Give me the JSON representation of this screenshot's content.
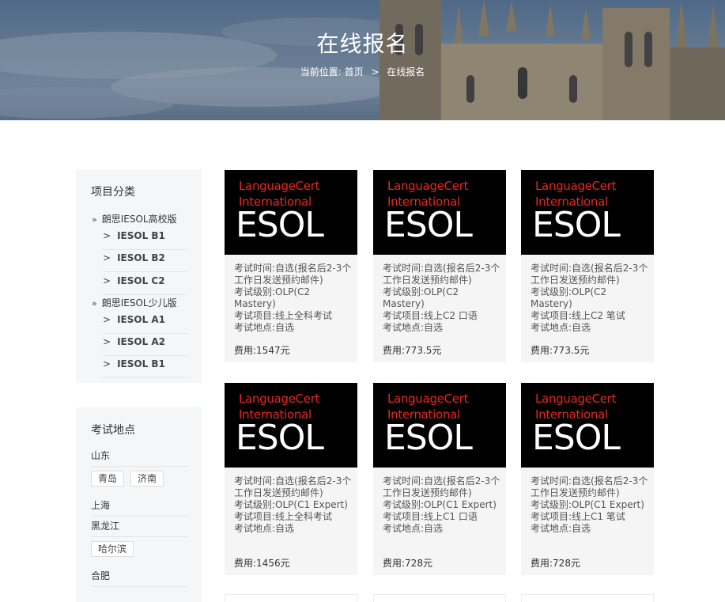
{
  "banner": {
    "title": "在线报名",
    "breadcrumb": {
      "prefix": "当前位置:",
      "home": "首页",
      "separator": ">",
      "current": "在线报名"
    }
  },
  "sidebar": {
    "category_title": "项目分类",
    "groups": [
      {
        "icon": "»",
        "label": "朗思IESOL高校版",
        "items": [
          {
            "arrow": ">",
            "label": "IESOL B1"
          },
          {
            "arrow": ">",
            "label": "IESOL B2"
          },
          {
            "arrow": ">",
            "label": "IESOL C2"
          }
        ]
      },
      {
        "icon": "»",
        "label": "朗思IESOL少儿版",
        "items": [
          {
            "arrow": ">",
            "label": "IESOL A1"
          },
          {
            "arrow": ">",
            "label": "IESOL A2"
          },
          {
            "arrow": ">",
            "label": "IESOL B1"
          }
        ]
      }
    ],
    "location_title": "考试地点",
    "locations": [
      {
        "province": "山东",
        "cities": [
          "青岛",
          "济南"
        ]
      },
      {
        "province": "上海",
        "cities": []
      },
      {
        "province": "黑龙江",
        "cities": [
          "哈尔滨"
        ]
      },
      {
        "province": "合肥",
        "cities": []
      }
    ]
  },
  "cards": [
    {
      "logo": {
        "line1": "LanguageCert",
        "line2": "International",
        "line3": "ESOL"
      },
      "info": [
        "考试时间:自选(报名后2-3个工作日发送预约邮件)",
        "考试级别:OLP(C2 Mastery)",
        "考试项目:线上全科考试",
        "考试地点:自选"
      ],
      "price": "费用:1547元"
    },
    {
      "logo": {
        "line1": "LanguageCert",
        "line2": "International",
        "line3": "ESOL"
      },
      "info": [
        "考试时间:自选(报名后2-3个工作日发送预约邮件)",
        "考试级别:OLP(C2 Mastery)",
        "考试项目:线上C2 口语",
        "考试地点:自选"
      ],
      "price": "费用:773.5元"
    },
    {
      "logo": {
        "line1": "LanguageCert",
        "line2": "International",
        "line3": "ESOL"
      },
      "info": [
        "考试时间:自选(报名后2-3个工作日发送预约邮件)",
        "考试级别:OLP(C2 Mastery)",
        "考试项目:线上C2 笔试",
        "考试地点:自选"
      ],
      "price": "费用:773.5元"
    },
    {
      "logo": {
        "line1": "LanguageCert",
        "line2": "International",
        "line3": "ESOL"
      },
      "info": [
        "考试时间:自选(报名后2-3个工作日发送预约邮件)",
        "考试级别:OLP(C1 Expert)",
        "考试项目:线上全科考试",
        "考试地点:自选"
      ],
      "price": "费用:1456元"
    },
    {
      "logo": {
        "line1": "LanguageCert",
        "line2": "International",
        "line3": "ESOL"
      },
      "info": [
        "考试时间:自选(报名后2-3个工作日发送预约邮件)",
        "考试级别:OLP(C1 Expert)",
        "考试项目:线上C1 口语",
        "考试地点:自选"
      ],
      "price": "费用:728元"
    },
    {
      "logo": {
        "line1": "LanguageCert",
        "line2": "International",
        "line3": "ESOL"
      },
      "info": [
        "考试时间:自选(报名后2-3个工作日发送预约邮件)",
        "考试级别:OLP(C1 Expert)",
        "考试项目:线上C1 笔试",
        "考试地点:自选"
      ],
      "price": "费用:728元"
    }
  ],
  "colors": {
    "logo_red": "#e8261f",
    "logo_bg": "#000000",
    "panel_bg": "#f5f6f7"
  }
}
